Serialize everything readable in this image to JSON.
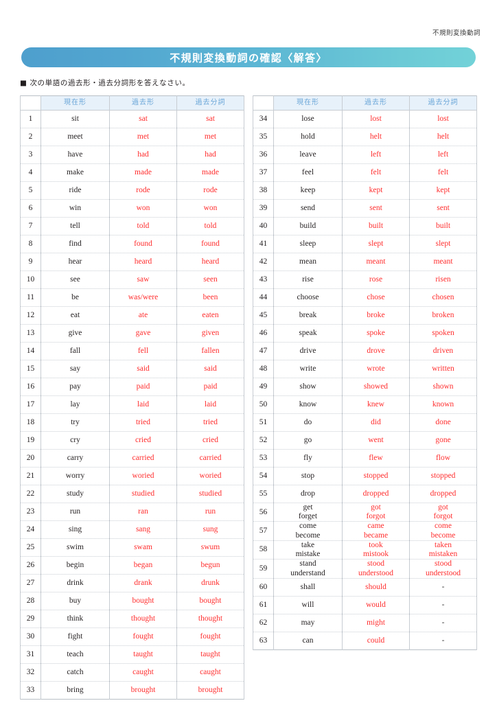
{
  "running_head": "不規則変換動詞",
  "banner": {
    "title": "不規則変換動詞の確認〈解答〉",
    "gradient_from": "#4e9fcd",
    "gradient_to": "#72d2d8"
  },
  "instruction": "■ 次の単語の過去形・過去分詞形を答えなさい。",
  "colors": {
    "answer_red": "#ff2d2d",
    "header_text_blue": "#6aa6d8",
    "header_bg_blue": "#e7f1fa",
    "body_text": "#231f20"
  },
  "table_headers": {
    "number": "",
    "present": "現在形",
    "past": "過去形",
    "past_participle": "過去分詞"
  },
  "left_table": {
    "rows": [
      {
        "no": "1",
        "present": "sit",
        "past": "sat",
        "pp": "sat"
      },
      {
        "no": "2",
        "present": "meet",
        "past": "met",
        "pp": "met"
      },
      {
        "no": "3",
        "present": "have",
        "past": "had",
        "pp": "had"
      },
      {
        "no": "4",
        "present": "make",
        "past": "made",
        "pp": "made"
      },
      {
        "no": "5",
        "present": "ride",
        "past": "rode",
        "pp": "rode"
      },
      {
        "no": "6",
        "present": "win",
        "past": "won",
        "pp": "won"
      },
      {
        "no": "7",
        "present": "tell",
        "past": "told",
        "pp": "told"
      },
      {
        "no": "8",
        "present": "find",
        "past": "found",
        "pp": "found"
      },
      {
        "no": "9",
        "present": "hear",
        "past": "heard",
        "pp": "heard"
      },
      {
        "no": "10",
        "present": "see",
        "past": "saw",
        "pp": "seen"
      },
      {
        "no": "11",
        "present": "be",
        "past": "was/were",
        "pp": "been"
      },
      {
        "no": "12",
        "present": "eat",
        "past": "ate",
        "pp": "eaten"
      },
      {
        "no": "13",
        "present": "give",
        "past": "gave",
        "pp": "given"
      },
      {
        "no": "14",
        "present": "fall",
        "past": "fell",
        "pp": "fallen"
      },
      {
        "no": "15",
        "present": "say",
        "past": "said",
        "pp": "said"
      },
      {
        "no": "16",
        "present": "pay",
        "past": "paid",
        "pp": "paid"
      },
      {
        "no": "17",
        "present": "lay",
        "past": "laid",
        "pp": "laid"
      },
      {
        "no": "18",
        "present": "try",
        "past": "tried",
        "pp": "tried"
      },
      {
        "no": "19",
        "present": "cry",
        "past": "cried",
        "pp": "cried"
      },
      {
        "no": "20",
        "present": "carry",
        "past": "carried",
        "pp": "carried"
      },
      {
        "no": "21",
        "present": "worry",
        "past": "woried",
        "pp": "woried"
      },
      {
        "no": "22",
        "present": "study",
        "past": "studied",
        "pp": "studied"
      },
      {
        "no": "23",
        "present": "run",
        "past": "ran",
        "pp": "run"
      },
      {
        "no": "24",
        "present": "sing",
        "past": "sang",
        "pp": "sung"
      },
      {
        "no": "25",
        "present": "swim",
        "past": "swam",
        "pp": "swum"
      },
      {
        "no": "26",
        "present": "begin",
        "past": "began",
        "pp": "begun"
      },
      {
        "no": "27",
        "present": "drink",
        "past": "drank",
        "pp": "drunk"
      },
      {
        "no": "28",
        "present": "buy",
        "past": "bought",
        "pp": "bought"
      },
      {
        "no": "29",
        "present": "think",
        "past": "thought",
        "pp": "thought"
      },
      {
        "no": "30",
        "present": "fight",
        "past": "fought",
        "pp": "fought"
      },
      {
        "no": "31",
        "present": "teach",
        "past": "taught",
        "pp": "taught"
      },
      {
        "no": "32",
        "present": "catch",
        "past": "caught",
        "pp": "caught"
      },
      {
        "no": "33",
        "present": "bring",
        "past": "brought",
        "pp": "brought"
      }
    ]
  },
  "right_table": {
    "rows": [
      {
        "no": "34",
        "present": "lose",
        "past": "lost",
        "pp": "lost"
      },
      {
        "no": "35",
        "present": "hold",
        "past": "helt",
        "pp": "helt"
      },
      {
        "no": "36",
        "present": "leave",
        "past": "left",
        "pp": "left"
      },
      {
        "no": "37",
        "present": "feel",
        "past": "felt",
        "pp": "felt"
      },
      {
        "no": "38",
        "present": "keep",
        "past": "kept",
        "pp": "kept"
      },
      {
        "no": "39",
        "present": "send",
        "past": "sent",
        "pp": "sent"
      },
      {
        "no": "40",
        "present": "build",
        "past": "built",
        "pp": "built"
      },
      {
        "no": "41",
        "present": "sleep",
        "past": "slept",
        "pp": "slept"
      },
      {
        "no": "42",
        "present": "mean",
        "past": "meant",
        "pp": "meant"
      },
      {
        "no": "43",
        "present": "rise",
        "past": "rose",
        "pp": "risen"
      },
      {
        "no": "44",
        "present": "choose",
        "past": "chose",
        "pp": "chosen"
      },
      {
        "no": "45",
        "present": "break",
        "past": "broke",
        "pp": "broken"
      },
      {
        "no": "46",
        "present": "speak",
        "past": "spoke",
        "pp": "spoken"
      },
      {
        "no": "47",
        "present": "drive",
        "past": "drove",
        "pp": "driven"
      },
      {
        "no": "48",
        "present": "write",
        "past": "wrote",
        "pp": "written"
      },
      {
        "no": "49",
        "present": "show",
        "past": "showed",
        "pp": "shown"
      },
      {
        "no": "50",
        "present": "know",
        "past": "knew",
        "pp": "known"
      },
      {
        "no": "51",
        "present": "do",
        "past": "did",
        "pp": "done"
      },
      {
        "no": "52",
        "present": "go",
        "past": "went",
        "pp": "gone"
      },
      {
        "no": "53",
        "present": "fly",
        "past": "flew",
        "pp": "flow"
      },
      {
        "no": "54",
        "present": "stop",
        "past": "stopped",
        "pp": "stopped"
      },
      {
        "no": "55",
        "present": "drop",
        "past": "dropped",
        "pp": "dropped"
      },
      {
        "no": "56",
        "present": "get\nforget",
        "past": "got\nforgot",
        "pp": "got\nforgot"
      },
      {
        "no": "57",
        "present": "come\nbecome",
        "past": "came\nbecame",
        "pp": "come\nbecome"
      },
      {
        "no": "58",
        "present": "take\nmistake",
        "past": "took\nmistook",
        "pp": "taken\nmistaken"
      },
      {
        "no": "59",
        "present": "stand\nunderstand",
        "past": "stood\nunderstood",
        "pp": "stood\nunderstood"
      },
      {
        "no": "60",
        "present": "shall",
        "past": "should",
        "pp": "-"
      },
      {
        "no": "61",
        "present": "will",
        "past": "would",
        "pp": "-"
      },
      {
        "no": "62",
        "present": "may",
        "past": "might",
        "pp": "-"
      },
      {
        "no": "63",
        "present": "can",
        "past": "could",
        "pp": "-"
      }
    ]
  }
}
